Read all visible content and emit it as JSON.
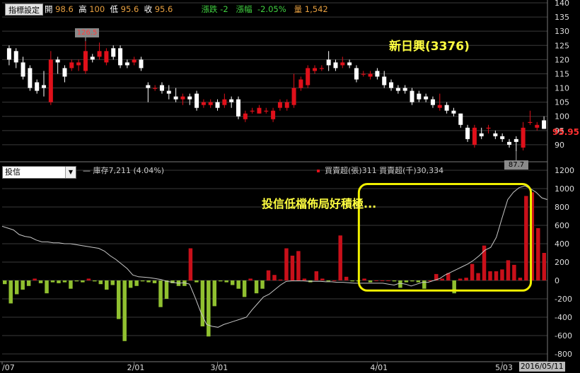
{
  "toolbar": {
    "indicator_button": "指標設定"
  },
  "quote": {
    "open_label": "開",
    "open": "98.6",
    "high_label": "高",
    "high": "100",
    "low_label": "低",
    "low": "95.6",
    "close_label": "收",
    "close": "95.6",
    "change_label": "漲跌",
    "change": "-2",
    "pct_label": "漲幅",
    "pct": "-2.05%",
    "vol_label": "量",
    "vol": "1,542"
  },
  "stock_title": "新日興(3376)",
  "last_price_label": "95.95",
  "high_marker": "126.5",
  "low_marker": "87.7",
  "lower_panel": {
    "selector_value": "投信",
    "inventory_legend": "庫存7,211 (4.04%)",
    "netbuy_legend": "買賣超(張)311 買賣超(千)30,334",
    "annotation": "投信低檔佈局好積極..."
  },
  "colors": {
    "up": "#e0101a",
    "down": "#ffffff",
    "buy": "#c8101a",
    "sell": "#90c030",
    "highlight": "#f0f000",
    "grid": "#3a3a3a"
  },
  "chart_data": [
    {
      "type": "candlestick",
      "title": "新日興(3376)",
      "ylim": [
        85,
        140
      ],
      "y_ticks": [
        90,
        95,
        100,
        105,
        110,
        115,
        120,
        125,
        130,
        135,
        140
      ],
      "x_tick_labels": [
        "/07",
        "2/01",
        "3/01",
        "4/01",
        "5/03"
      ],
      "x_tick_index": [
        0,
        18,
        30,
        53,
        71
      ],
      "candles": [
        {
          "o": 124,
          "h": 125,
          "l": 118,
          "c": 120
        },
        {
          "o": 123,
          "h": 124,
          "l": 117,
          "c": 119
        },
        {
          "o": 119,
          "h": 121,
          "l": 113,
          "c": 114
        },
        {
          "o": 117,
          "h": 118,
          "l": 109,
          "c": 110
        },
        {
          "o": 112,
          "h": 113,
          "l": 108,
          "c": 109
        },
        {
          "o": 111,
          "h": 116,
          "l": 107,
          "c": 110
        },
        {
          "o": 105,
          "h": 123,
          "l": 104,
          "c": 120
        },
        {
          "o": 120,
          "h": 121,
          "l": 115,
          "c": 119
        },
        {
          "o": 117,
          "h": 118,
          "l": 112,
          "c": 114
        },
        {
          "o": 117,
          "h": 120,
          "l": 116,
          "c": 119
        },
        {
          "o": 118,
          "h": 120,
          "l": 116,
          "c": 119
        },
        {
          "o": 116,
          "h": 126.5,
          "l": 115,
          "c": 123
        },
        {
          "o": 121,
          "h": 122,
          "l": 119,
          "c": 120
        },
        {
          "o": 121,
          "h": 126,
          "l": 120,
          "c": 123
        },
        {
          "o": 119,
          "h": 124,
          "l": 118,
          "c": 123
        },
        {
          "o": 124,
          "h": 125,
          "l": 120,
          "c": 121
        },
        {
          "o": 124,
          "h": 125,
          "l": 117,
          "c": 118
        },
        {
          "o": 119,
          "h": 120,
          "l": 117,
          "c": 118
        },
        {
          "o": 119,
          "h": 121,
          "l": 118,
          "c": 120
        },
        {
          "o": 120,
          "h": 121,
          "l": 116,
          "c": 117
        },
        {
          "o": 111,
          "h": 112,
          "l": 105,
          "c": 110
        },
        {
          "o": 110,
          "h": 111,
          "l": 109,
          "c": 110
        },
        {
          "o": 111,
          "h": 112,
          "l": 108,
          "c": 109
        },
        {
          "o": 109,
          "h": 111,
          "l": 106,
          "c": 108
        },
        {
          "o": 107,
          "h": 110,
          "l": 105,
          "c": 106
        },
        {
          "o": 106,
          "h": 108,
          "l": 104,
          "c": 107
        },
        {
          "o": 107,
          "h": 108,
          "l": 104,
          "c": 106
        },
        {
          "o": 108,
          "h": 109,
          "l": 102,
          "c": 103
        },
        {
          "o": 104,
          "h": 106,
          "l": 103,
          "c": 105
        },
        {
          "o": 104,
          "h": 106,
          "l": 103,
          "c": 105
        },
        {
          "o": 105,
          "h": 106,
          "l": 102,
          "c": 103
        },
        {
          "o": 104,
          "h": 108,
          "l": 103,
          "c": 106
        },
        {
          "o": 106,
          "h": 107,
          "l": 103,
          "c": 105
        },
        {
          "o": 106,
          "h": 107,
          "l": 99,
          "c": 100
        },
        {
          "o": 99,
          "h": 102,
          "l": 98,
          "c": 101
        },
        {
          "o": 102,
          "h": 103,
          "l": 101,
          "c": 102
        },
        {
          "o": 101,
          "h": 104,
          "l": 101,
          "c": 103
        },
        {
          "o": 102,
          "h": 103,
          "l": 101,
          "c": 102
        },
        {
          "o": 99,
          "h": 103,
          "l": 98,
          "c": 102
        },
        {
          "o": 103,
          "h": 106,
          "l": 102,
          "c": 105
        },
        {
          "o": 103,
          "h": 106,
          "l": 102,
          "c": 105
        },
        {
          "o": 104,
          "h": 115,
          "l": 103,
          "c": 110
        },
        {
          "o": 110,
          "h": 114,
          "l": 109,
          "c": 113
        },
        {
          "o": 111,
          "h": 118,
          "l": 110,
          "c": 117
        },
        {
          "o": 116,
          "h": 118,
          "l": 115,
          "c": 117
        },
        {
          "o": 117,
          "h": 118,
          "l": 116,
          "c": 117
        },
        {
          "o": 120,
          "h": 123,
          "l": 116,
          "c": 118
        },
        {
          "o": 119,
          "h": 120,
          "l": 116,
          "c": 117
        },
        {
          "o": 118,
          "h": 121,
          "l": 117,
          "c": 119
        },
        {
          "o": 119,
          "h": 120,
          "l": 117,
          "c": 118
        },
        {
          "o": 117,
          "h": 118,
          "l": 112,
          "c": 113
        },
        {
          "o": 115,
          "h": 116,
          "l": 114,
          "c": 115
        },
        {
          "o": 114,
          "h": 116,
          "l": 113,
          "c": 115
        },
        {
          "o": 116,
          "h": 117,
          "l": 113,
          "c": 114
        },
        {
          "o": 114,
          "h": 116,
          "l": 110,
          "c": 111
        },
        {
          "o": 112,
          "h": 113,
          "l": 109,
          "c": 110
        },
        {
          "o": 110,
          "h": 111,
          "l": 108,
          "c": 109
        },
        {
          "o": 110,
          "h": 111,
          "l": 108,
          "c": 109
        },
        {
          "o": 109,
          "h": 110,
          "l": 104,
          "c": 105
        },
        {
          "o": 108,
          "h": 109,
          "l": 105,
          "c": 106
        },
        {
          "o": 107,
          "h": 108,
          "l": 105,
          "c": 106
        },
        {
          "o": 106,
          "h": 107,
          "l": 103,
          "c": 104
        },
        {
          "o": 103,
          "h": 108,
          "l": 102,
          "c": 104
        },
        {
          "o": 104,
          "h": 105,
          "l": 101,
          "c": 102
        },
        {
          "o": 102,
          "h": 103,
          "l": 100,
          "c": 101
        },
        {
          "o": 101,
          "h": 101,
          "l": 96,
          "c": 97
        },
        {
          "o": 96,
          "h": 97,
          "l": 91,
          "c": 92
        },
        {
          "o": 90,
          "h": 97,
          "l": 89,
          "c": 96
        },
        {
          "o": 94,
          "h": 96,
          "l": 92,
          "c": 93
        },
        {
          "o": 96,
          "h": 97,
          "l": 94,
          "c": 96
        },
        {
          "o": 94,
          "h": 95,
          "l": 92,
          "c": 93
        },
        {
          "o": 93,
          "h": 94,
          "l": 91,
          "c": 92
        },
        {
          "o": 91,
          "h": 92,
          "l": 89,
          "c": 90
        },
        {
          "o": 92,
          "h": 93,
          "l": 87.7,
          "c": 91
        },
        {
          "o": 89,
          "h": 98,
          "l": 88,
          "c": 96
        },
        {
          "o": 98,
          "h": 102,
          "l": 97,
          "c": 98
        },
        {
          "o": 96,
          "h": 98,
          "l": 95,
          "c": 97
        },
        {
          "o": 98.6,
          "h": 100,
          "l": 95.6,
          "c": 95.6
        }
      ]
    },
    {
      "type": "bar+line",
      "title": "投信",
      "ylim": [
        -800,
        1200
      ],
      "y_ticks": [
        -800,
        -600,
        -400,
        -200,
        0,
        200,
        400,
        600,
        800,
        1000,
        1200
      ],
      "series": [
        {
          "name": "買賣超(張)",
          "type": "bar",
          "values": [
            -40,
            -250,
            -150,
            -100,
            -60,
            20,
            -30,
            -140,
            -20,
            -30,
            -20,
            -90,
            -10,
            -20,
            20,
            -10,
            -40,
            -100,
            -50,
            -420,
            -660,
            -80,
            -60,
            -10,
            -20,
            -30,
            -290,
            -200,
            -30,
            -60,
            -60,
            350,
            -20,
            -500,
            -610,
            -280,
            -10,
            -20,
            -50,
            -90,
            -180,
            20,
            -140,
            -90,
            110,
            60,
            10,
            350,
            270,
            320,
            20,
            -20,
            100,
            20,
            -10,
            0,
            490,
            40,
            -10,
            -10,
            20,
            -20,
            0,
            0,
            0,
            -10,
            -80,
            -20,
            -10,
            -20,
            -90,
            0,
            70,
            20,
            80,
            -140,
            20,
            30,
            180,
            80,
            380,
            100,
            100,
            120,
            220,
            170,
            30,
            920,
            960,
            570,
            300
          ]
        },
        {
          "name": "庫存",
          "type": "line",
          "values": [
            590,
            570,
            550,
            500,
            480,
            470,
            440,
            420,
            420,
            410,
            410,
            400,
            400,
            390,
            380,
            370,
            360,
            350,
            320,
            270,
            230,
            180,
            130,
            60,
            40,
            35,
            30,
            20,
            10,
            -10,
            -20,
            -30,
            -25,
            -40,
            -190,
            -350,
            -480,
            -500,
            -510,
            -480,
            -460,
            -440,
            -420,
            -400,
            -320,
            -250,
            -180,
            -150,
            -100,
            -50,
            -10,
            -5,
            -5,
            -5,
            -10,
            -10,
            -10,
            -15,
            -15,
            -20,
            -20,
            -25,
            -30,
            -30,
            -30,
            -30,
            -30,
            -30,
            -40,
            -50,
            -30,
            -40,
            -60,
            -40,
            -20,
            -20,
            0,
            20,
            60,
            90,
            120,
            150,
            180,
            220,
            270,
            330,
            360,
            470,
            680,
            880,
            960,
            1010,
            1030,
            1000,
            960,
            900,
            880
          ]
        }
      ],
      "highlight_box": {
        "x_from_index": 60,
        "x_to_index": 87,
        "y_from": -110,
        "y_to": 1050
      }
    }
  ]
}
